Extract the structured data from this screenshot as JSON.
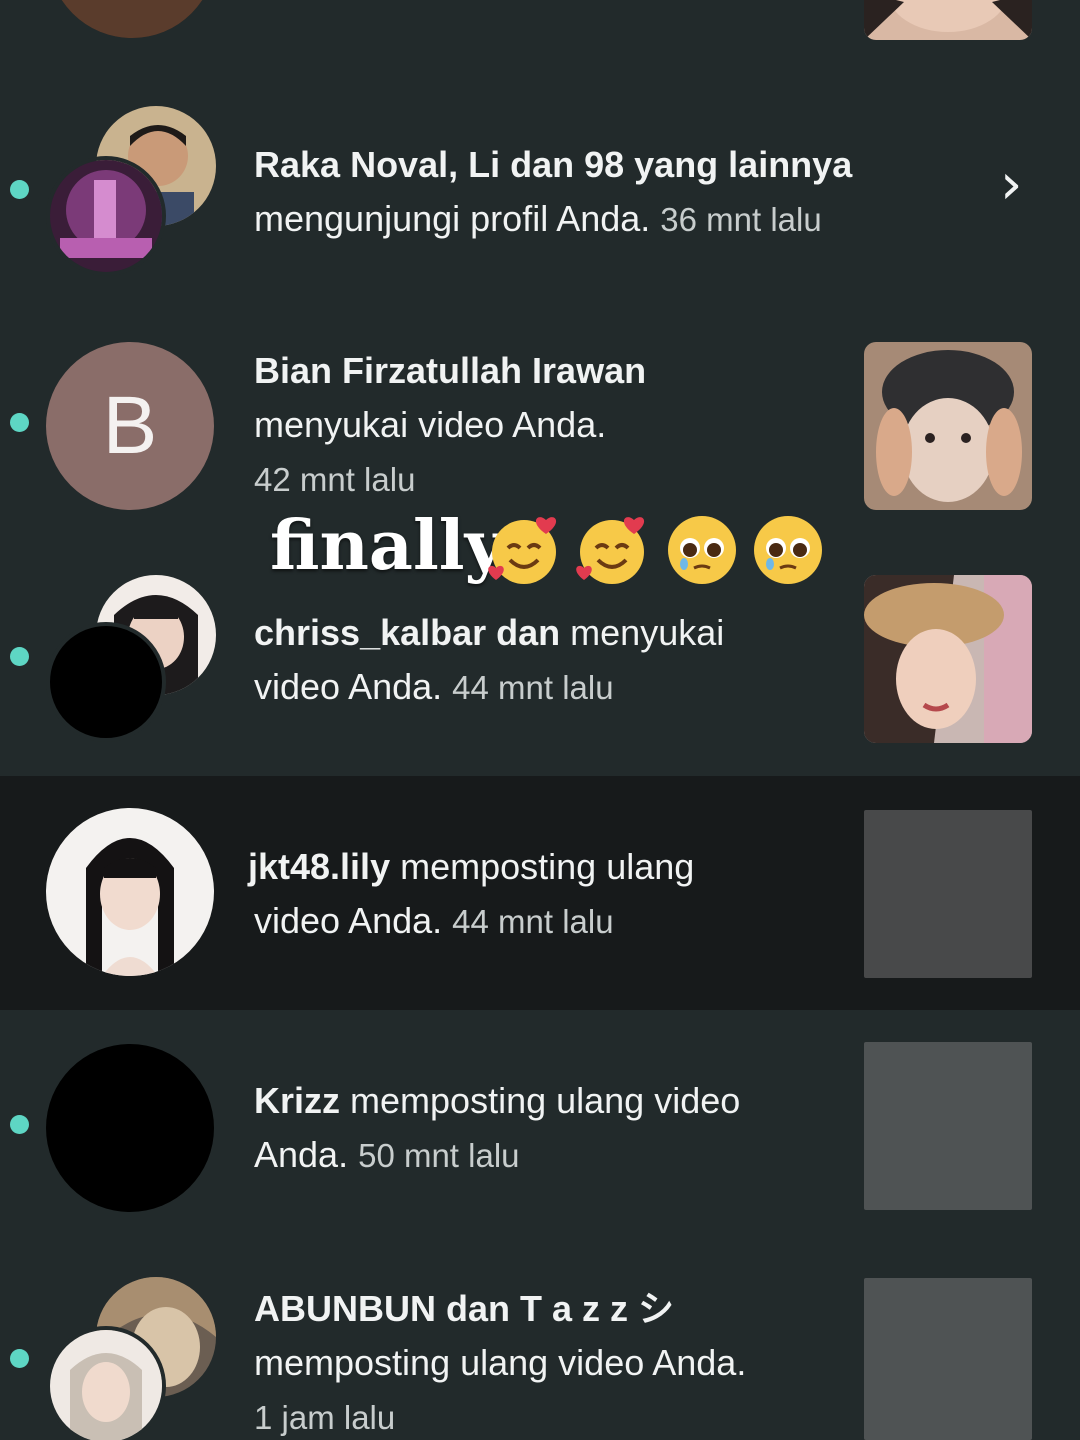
{
  "notifications": [
    {
      "id": "visitors",
      "name": "Raka Noval, Li dan 98 yang lainnya",
      "action": "mengunjungi profil Anda.",
      "time": "36 mnt lalu",
      "unread": true
    },
    {
      "id": "bian",
      "name": "Bian Firzatullah Irawan",
      "action": "menyukai video Anda.",
      "time": "42 mnt lalu",
      "avatar_letter": "B",
      "unread": true
    },
    {
      "id": "chriss",
      "name": "chriss_kalbar dan ",
      "action_1": "menyukai",
      "action_2": "video Anda.",
      "time": "44 mnt lalu",
      "unread": true
    },
    {
      "id": "lily",
      "name": "jkt48.lily",
      "action_1": "memposting ulang",
      "action_2": "video Anda.",
      "time": "44 mnt lalu",
      "unread": false
    },
    {
      "id": "krizz",
      "name": "Krizz",
      "action_1": "memposting ulang video",
      "action_2": "Anda.",
      "time": "50 mnt lalu",
      "unread": true
    },
    {
      "id": "abunbun",
      "name": "ABUNBUN dan T a z z シ",
      "action": "memposting ulang video Anda.",
      "time": "1 jam lalu",
      "unread": true
    }
  ],
  "overlay": {
    "caption": "finally"
  },
  "colors": {
    "background": "#222a2b",
    "highlight_row": "#171a1b",
    "unread_dot": "#5ed6c4",
    "letter_avatar": "#8a6d69"
  }
}
